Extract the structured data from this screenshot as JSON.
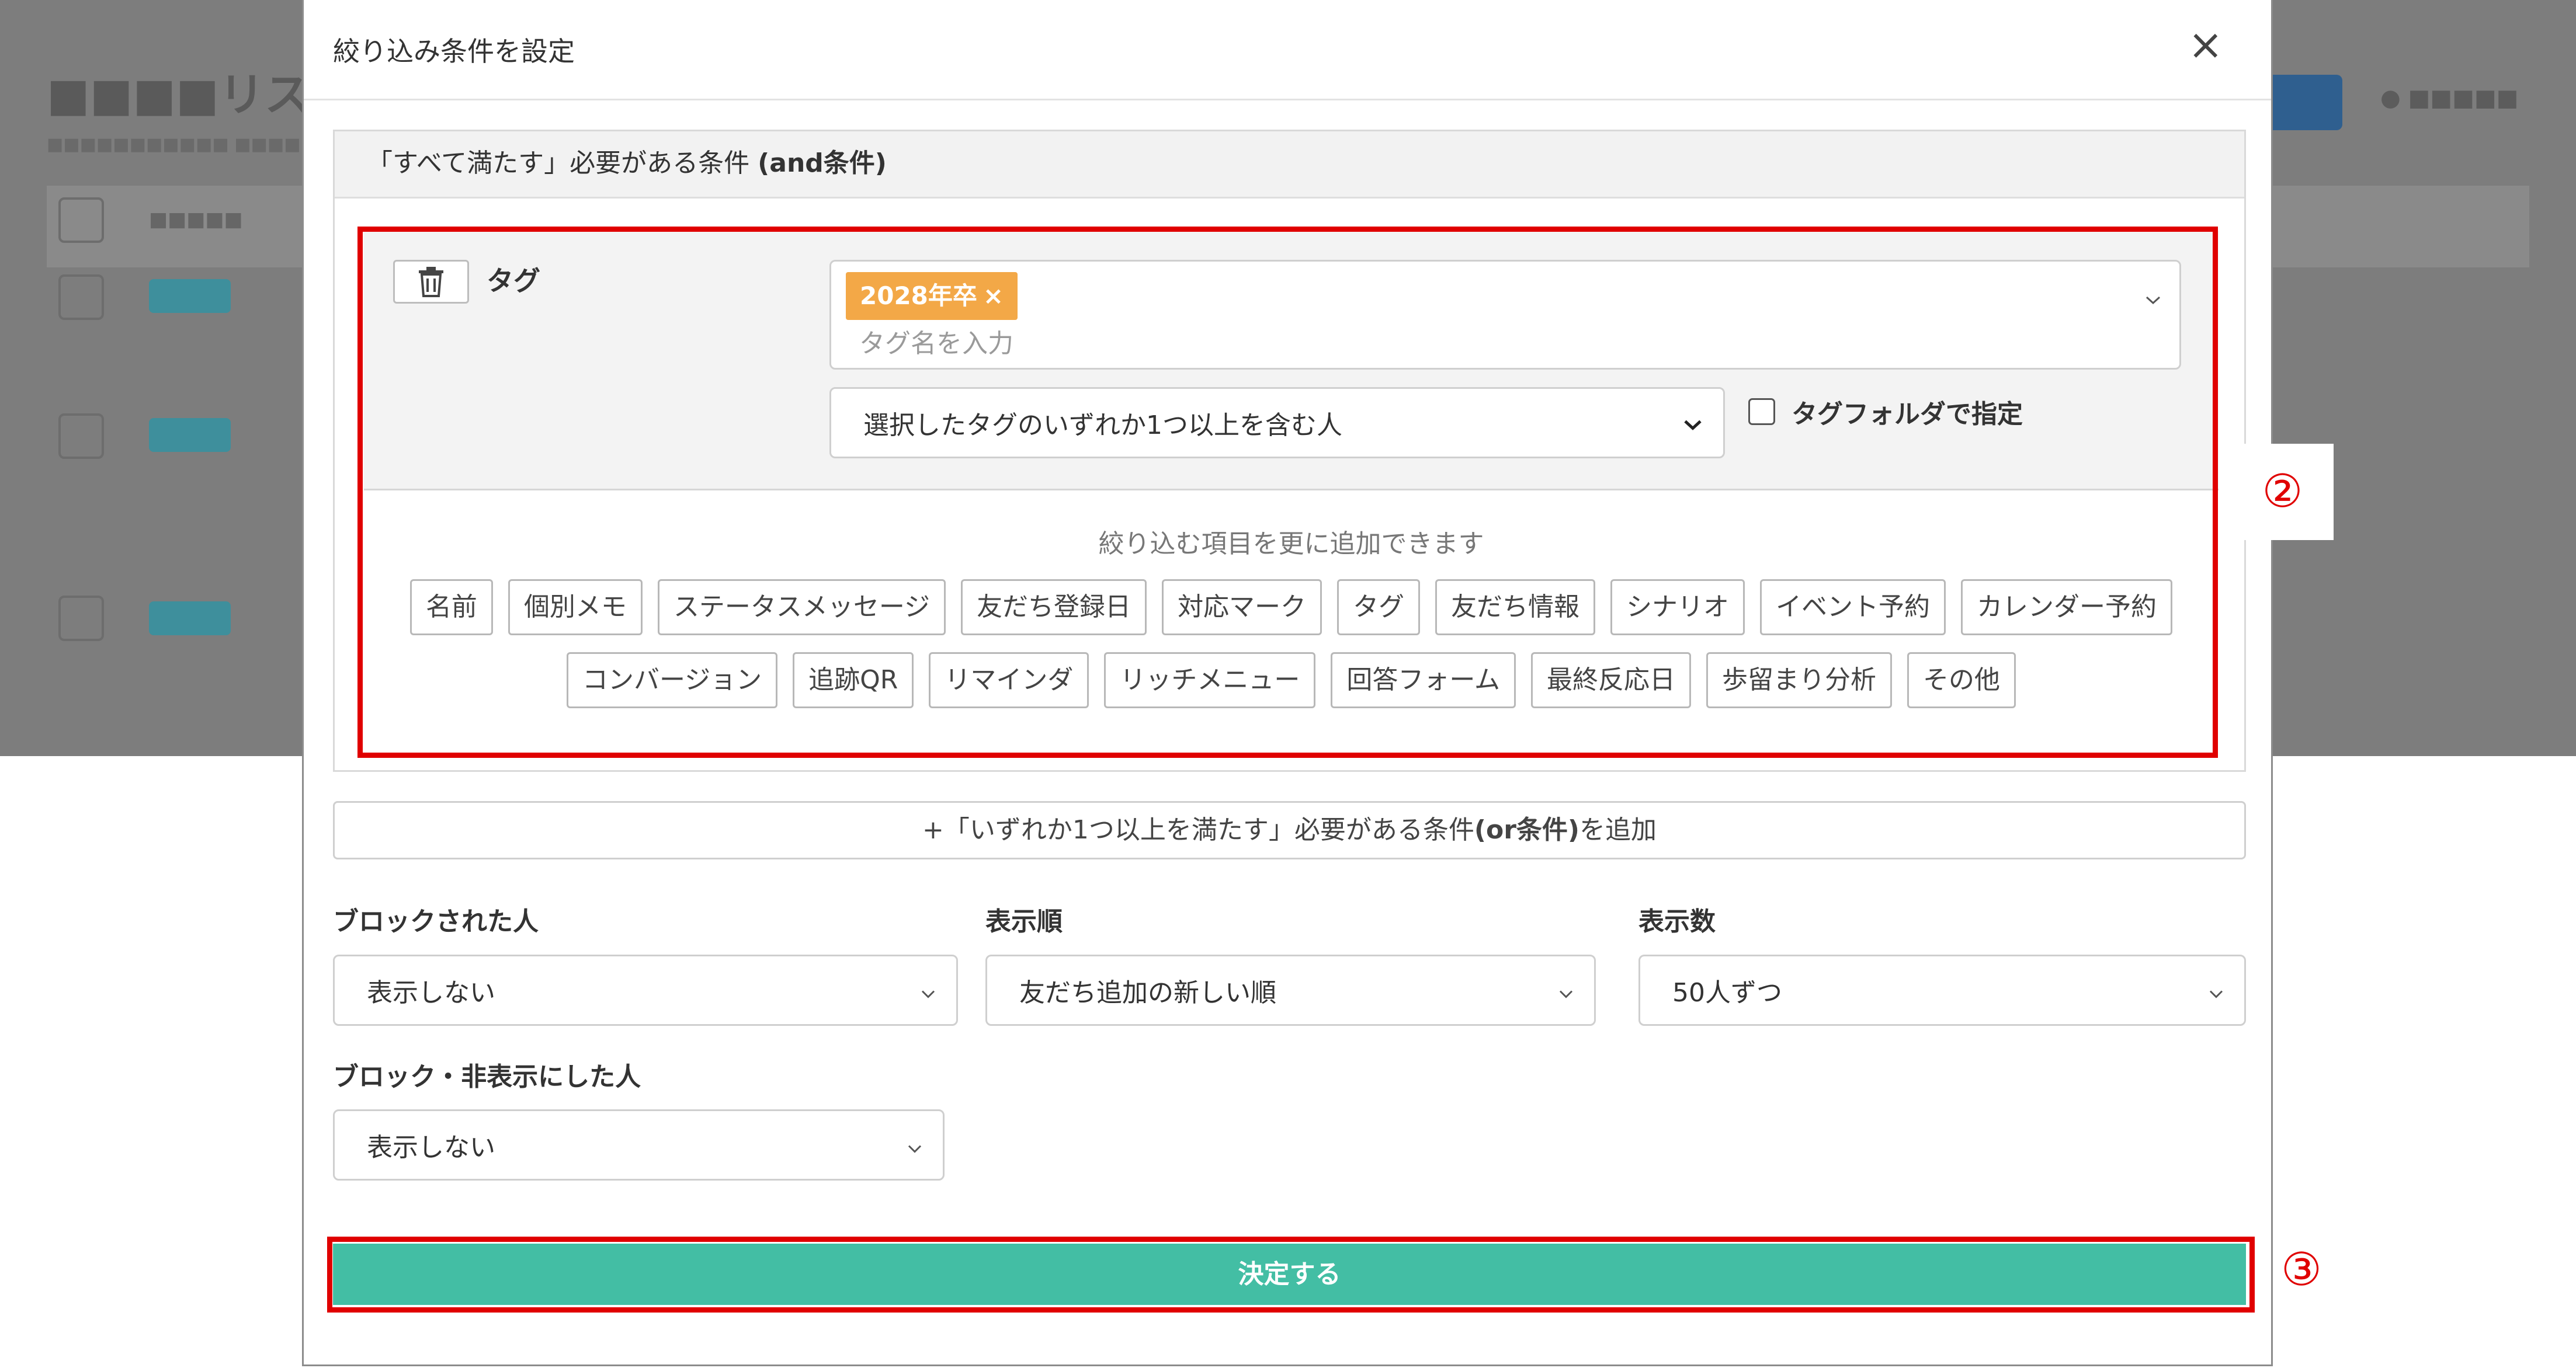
{
  "modal": {
    "title": "絞り込み条件を設定",
    "close_label": "×"
  },
  "and_section": {
    "header_prefix": "「すべて満たす」必要がある条件 ",
    "header_bold": "(and条件)"
  },
  "condition": {
    "label": "タグ",
    "selected_tag": "2028年卒",
    "selected_tag_remove": "×",
    "tag_input_placeholder": "タグ名を入力",
    "match_mode": "選択したタグのいずれか1つ以上を含む人",
    "folder_checkbox_label": "タグフォルダで指定"
  },
  "add_items": {
    "hint": "絞り込む項目を更に追加できます",
    "row1": [
      "名前",
      "個別メモ",
      "ステータスメッセージ",
      "友だち登録日",
      "対応マーク",
      "タグ",
      "友だち情報",
      "シナリオ",
      "イベント予約",
      "カレンダー予約"
    ],
    "row2": [
      "コンバージョン",
      "追跡QR",
      "リマインダ",
      "リッチメニュー",
      "回答フォーム",
      "最終反応日",
      "歩留まり分析",
      "その他"
    ]
  },
  "or_section": {
    "prefix": "+「いずれか1つ以上を満たす」必要がある条件",
    "bold": "(or条件)",
    "suffix": "を追加"
  },
  "filters": {
    "blocked_label": "ブロックされた人",
    "blocked_value": "表示しない",
    "order_label": "表示順",
    "order_value": "友だち追加の新しい順",
    "count_label": "表示数",
    "count_value": "50人ずつ",
    "hidden_label": "ブロック・非表示にした人",
    "hidden_value": "表示しない"
  },
  "submit_label": "決定する",
  "callouts": {
    "two": "②",
    "three": "③"
  },
  "colors": {
    "tag_chip": "#f3a847",
    "submit": "#43bea4",
    "highlight": "#e00000"
  },
  "icons": {
    "delete": "trash-icon",
    "select": "chevron-down-icon",
    "close": "close-icon"
  }
}
